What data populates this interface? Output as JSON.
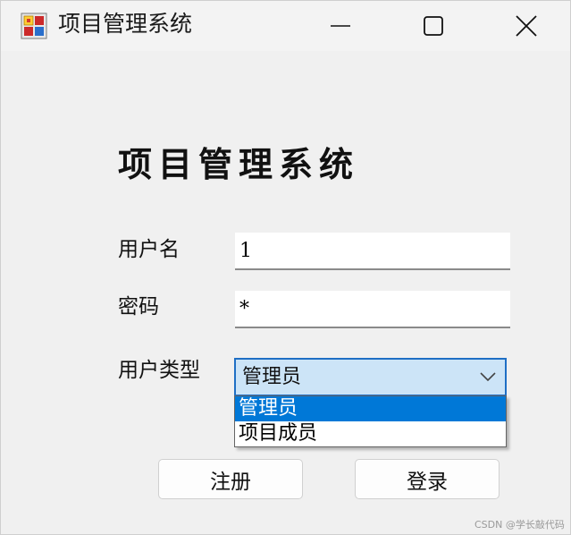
{
  "window": {
    "title": "项目管理系统",
    "icon": "app-window-icon",
    "controls": [
      "minimize-icon",
      "maximize-icon",
      "close-icon"
    ]
  },
  "form": {
    "heading": "项目管理系统",
    "username_label": "用户名",
    "username_value": "1",
    "password_label": "密码",
    "password_value": "*",
    "usertype_label": "用户类型",
    "usertype_selected": "管理员",
    "usertype_options": [
      "管理员",
      "项目成员"
    ],
    "register_button": "注册",
    "login_button": "登录"
  },
  "watermark": "CSDN @学长敲代码",
  "colors": {
    "selection": "#0078d7",
    "combo_focus_bg": "#cce4f7",
    "combo_focus_border": "#1f6fc5"
  }
}
